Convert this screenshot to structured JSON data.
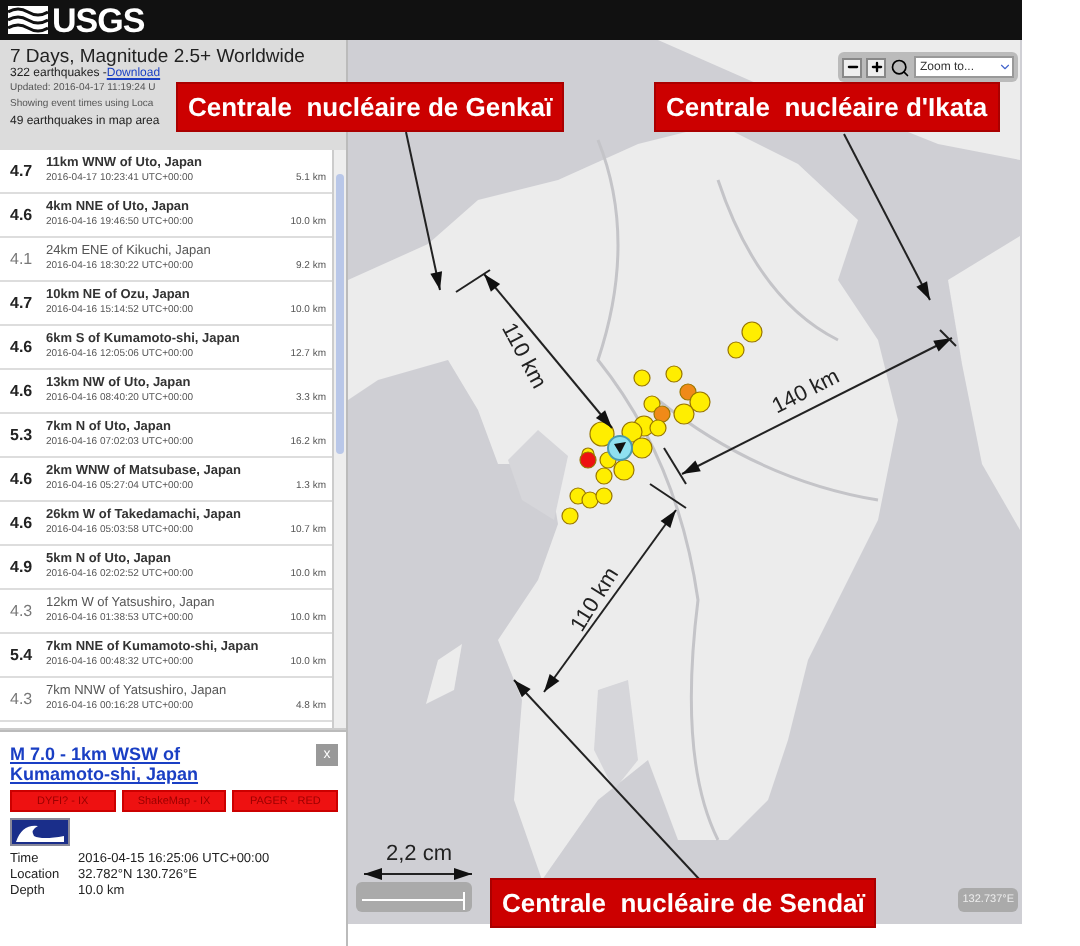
{
  "header": {
    "logo": "USGS"
  },
  "summary": {
    "title": "7 Days, Magnitude 2.5+ Worldwide",
    "count": "322 earthquakes - ",
    "download": "Download",
    "updated": "Updated: 2016-04-17 11:19:24 U",
    "showing": "Showing event times using Loca",
    "in_map": "49 earthquakes in map area"
  },
  "earthquakes": [
    {
      "magnitude": "4.7",
      "place": "11km WNW of Uto, Japan",
      "time": "2016-04-17 10:23:41 UTC+00:00",
      "depth": "5.1 km",
      "bold": true
    },
    {
      "magnitude": "4.6",
      "place": "4km NNE of Uto, Japan",
      "time": "2016-04-16 19:46:50 UTC+00:00",
      "depth": "10.0 km",
      "bold": true
    },
    {
      "magnitude": "4.1",
      "place": "24km ENE of Kikuchi, Japan",
      "time": "2016-04-16 18:30:22 UTC+00:00",
      "depth": "9.2 km",
      "bold": false
    },
    {
      "magnitude": "4.7",
      "place": "10km NE of Ozu, Japan",
      "time": "2016-04-16 15:14:52 UTC+00:00",
      "depth": "10.0 km",
      "bold": true
    },
    {
      "magnitude": "4.6",
      "place": "6km S of Kumamoto-shi, Japan",
      "time": "2016-04-16 12:05:06 UTC+00:00",
      "depth": "12.7 km",
      "bold": true
    },
    {
      "magnitude": "4.6",
      "place": "13km NW of Uto, Japan",
      "time": "2016-04-16 08:40:20 UTC+00:00",
      "depth": "3.3 km",
      "bold": true
    },
    {
      "magnitude": "5.3",
      "place": "7km N of Uto, Japan",
      "time": "2016-04-16 07:02:03 UTC+00:00",
      "depth": "16.2 km",
      "bold": true
    },
    {
      "magnitude": "4.6",
      "place": "2km WNW of Matsubase, Japan",
      "time": "2016-04-16 05:27:04 UTC+00:00",
      "depth": "1.3 km",
      "bold": true
    },
    {
      "magnitude": "4.6",
      "place": "26km W of Takedamachi, Japan",
      "time": "2016-04-16 05:03:58 UTC+00:00",
      "depth": "10.7 km",
      "bold": true
    },
    {
      "magnitude": "4.9",
      "place": "5km N of Uto, Japan",
      "time": "2016-04-16 02:02:52 UTC+00:00",
      "depth": "10.0 km",
      "bold": true
    },
    {
      "magnitude": "4.3",
      "place": "12km W of Yatsushiro, Japan",
      "time": "2016-04-16 01:38:53 UTC+00:00",
      "depth": "10.0 km",
      "bold": false
    },
    {
      "magnitude": "5.4",
      "place": "7km NNE of Kumamoto-shi, Japan",
      "time": "2016-04-16 00:48:32 UTC+00:00",
      "depth": "10.0 km",
      "bold": true
    },
    {
      "magnitude": "4.3",
      "place": "7km NNW of Yatsushiro, Japan",
      "time": "2016-04-16 00:16:28 UTC+00:00",
      "depth": "4.8 km",
      "bold": false
    }
  ],
  "popup": {
    "title": "M 7.0 - 1km WSW of Kumamoto-shi, Japan",
    "close": "x",
    "buttons": [
      "DYFI? - IX",
      "ShakeMap - IX",
      "PAGER - RED"
    ],
    "details": [
      {
        "label": "Time",
        "value": "2016-04-15 16:25:06 UTC+00:00"
      },
      {
        "label": "Location",
        "value": "32.782°N 130.726°E"
      },
      {
        "label": "Depth",
        "value": "10.0 km"
      }
    ]
  },
  "map": {
    "zoom_select": "Zoom to...",
    "coordinates": "132.737°E"
  },
  "annotations": {
    "labels": [
      "Centrale  nucléaire de Genkaï",
      "Centrale  nucléaire d'Ikata",
      "Centrale  nucléaire de Sendaï"
    ],
    "distances": [
      "110 km",
      "140 km",
      "110 km"
    ],
    "scale": "2,2 cm"
  }
}
